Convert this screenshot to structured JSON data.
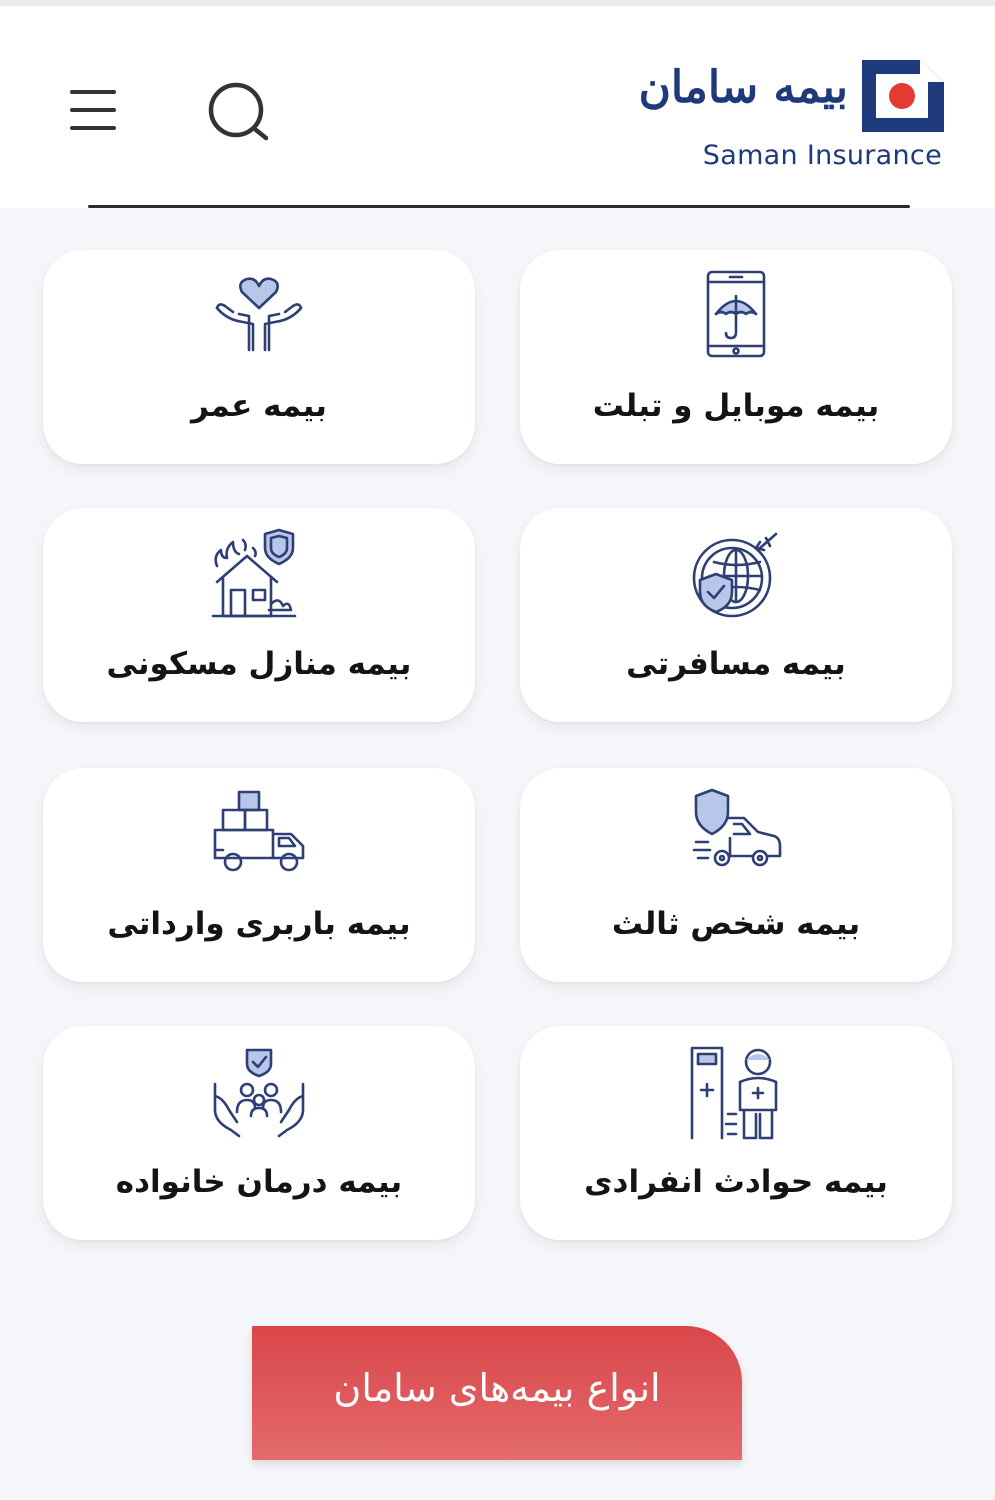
{
  "header": {
    "logo_fa": "بیمه سامان",
    "logo_en": "Saman Insurance",
    "menu_icon": "hamburger-menu-icon",
    "search_icon": "search-icon"
  },
  "brand_colors": {
    "navy": "#1f3a7a",
    "red": "#e53935",
    "cta": "#d9464a"
  },
  "cards": [
    {
      "label": "بیمه موبایل و تبلت",
      "icon": "phone-umbrella-icon"
    },
    {
      "label": "بیمه عمر",
      "icon": "hands-heart-icon"
    },
    {
      "label": "بیمه مسافرتی",
      "icon": "globe-shield-plane-icon"
    },
    {
      "label": "بیمه منازل مسکونی",
      "icon": "house-fire-shield-icon"
    },
    {
      "label": "بیمه شخص ثالث",
      "icon": "car-shield-icon"
    },
    {
      "label": "بیمه باربری وارداتی",
      "icon": "cargo-truck-icon"
    },
    {
      "label": "بیمه حوادث انفرادی",
      "icon": "injured-person-icon"
    },
    {
      "label": "بیمه درمان خانواده",
      "icon": "family-care-icon"
    }
  ],
  "cta": {
    "label": "انواع بیمه‌های سامان"
  }
}
